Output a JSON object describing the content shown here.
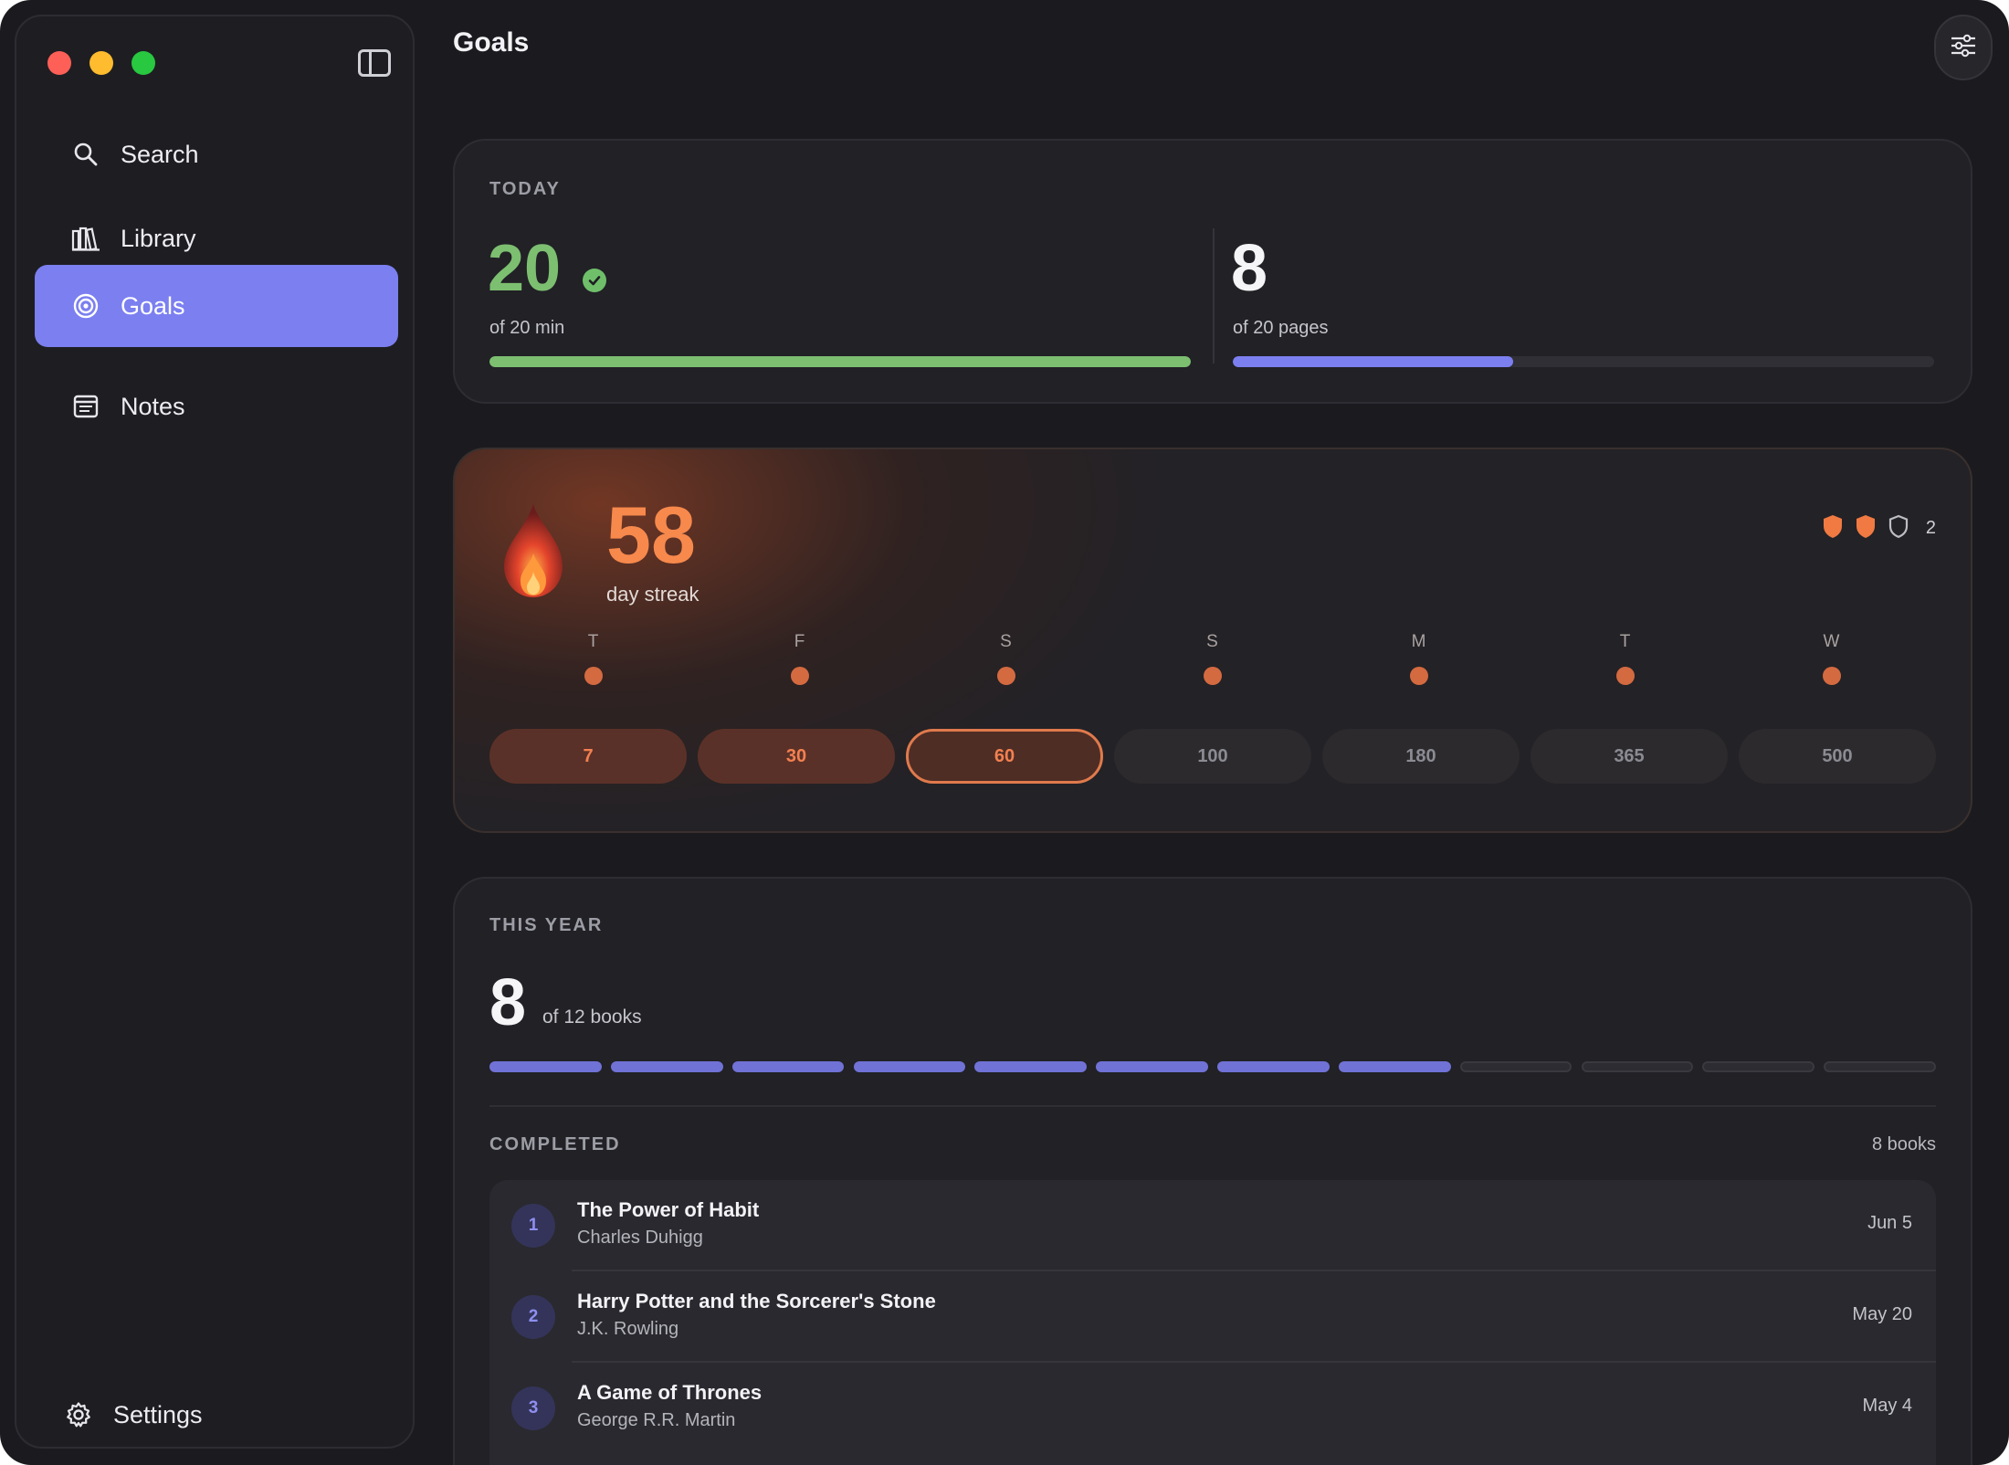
{
  "sidebar": {
    "items": [
      {
        "label": "Search",
        "icon": "search-icon"
      },
      {
        "label": "Library",
        "icon": "books-icon"
      },
      {
        "label": "Goals",
        "icon": "target-icon",
        "active": true
      },
      {
        "label": "Notes",
        "icon": "notes-icon"
      }
    ],
    "settings_label": "Settings"
  },
  "header": {
    "title": "Goals"
  },
  "today": {
    "label": "TODAY",
    "minutes": {
      "value": "20",
      "subtitle": "of 20 min",
      "progress": 1.0,
      "color": "#7dbf70",
      "complete": true
    },
    "pages": {
      "value": "8",
      "subtitle": "of 20 pages",
      "progress": 0.4,
      "color": "#7b7ff0"
    }
  },
  "streak": {
    "value": "58",
    "label": "day streak",
    "shield_count": "2",
    "shields": [
      "filled",
      "filled",
      "empty"
    ],
    "days": [
      "T",
      "F",
      "S",
      "S",
      "M",
      "T",
      "W"
    ],
    "milestones": [
      {
        "label": "7",
        "state": "done"
      },
      {
        "label": "30",
        "state": "done"
      },
      {
        "label": "60",
        "state": "current"
      },
      {
        "label": "100",
        "state": "future"
      },
      {
        "label": "180",
        "state": "future"
      },
      {
        "label": "365",
        "state": "future"
      },
      {
        "label": "500",
        "state": "future"
      }
    ],
    "accent": "#f7894c"
  },
  "this_year": {
    "label": "THIS YEAR",
    "count": "8",
    "subtitle": "of 12 books",
    "completed_segments": 8,
    "total_segments": 12,
    "completed_label": "COMPLETED",
    "completed_count": "8 books",
    "books": [
      {
        "rank": "1",
        "title": "The Power of Habit",
        "author": "Charles Duhigg",
        "date": "Jun 5"
      },
      {
        "rank": "2",
        "title": "Harry Potter and the Sorcerer's Stone",
        "author": "J.K. Rowling",
        "date": "May 20"
      },
      {
        "rank": "3",
        "title": "A Game of Thrones",
        "author": "George R.R. Martin",
        "date": "May 4"
      }
    ]
  }
}
